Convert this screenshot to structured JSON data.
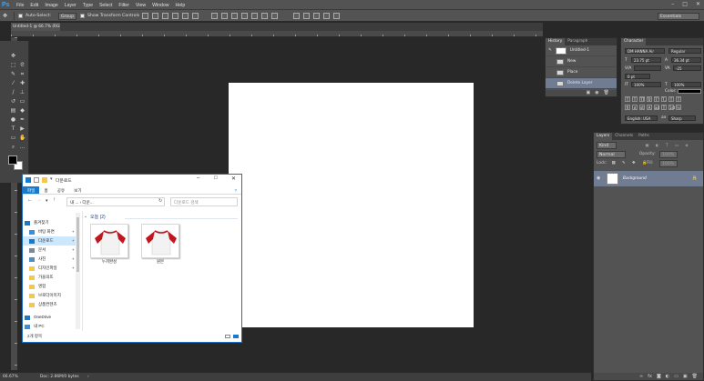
{
  "app": {
    "logo": "Ps",
    "menu": [
      "File",
      "Edit",
      "Image",
      "Layer",
      "Type",
      "Select",
      "Filter",
      "View",
      "Window",
      "Help"
    ],
    "window_controls": [
      "–",
      "□",
      "✕"
    ]
  },
  "options_bar": {
    "auto_select_label": "Auto-Select:",
    "auto_select_value": "Group",
    "show_transform_label": "Show Transform Controls",
    "workspace": "Essentials"
  },
  "document": {
    "tab_title": "Untitled-1 @ 66.7% (RGB/8) *"
  },
  "history_panel": {
    "tabs": [
      "History",
      "Paragraph"
    ],
    "snapshot": "Untitled-1",
    "items": [
      "New",
      "Place",
      "Delete Layer"
    ],
    "selected_index": 2
  },
  "character_panel": {
    "tab": "Character",
    "font_family": "DM HANNA Air",
    "font_style": "Regular",
    "font_size": "23.75 pt",
    "leading": "36.34 pt",
    "tracking": "-25",
    "kerning": "0 pt",
    "vertical_scale": "100%",
    "horizontal_scale": "100%",
    "color_label": "Color:",
    "style_buttons": [
      "T",
      "T",
      "TT",
      "Tr",
      "T'",
      "T,",
      "T",
      "T"
    ],
    "opentype_buttons": [
      "fi",
      "ơ",
      "st",
      "A",
      "ad",
      "T",
      "1st",
      "½"
    ],
    "language": "English: USA",
    "aa_label": "aa",
    "antialias": "Sharp"
  },
  "layers_panel": {
    "tabs": [
      "Layers",
      "Channels",
      "Paths"
    ],
    "filter_label": "Kind",
    "blend_mode": "Normal",
    "opacity_label": "Opacity:",
    "opacity": "100%",
    "lock_label": "Lock:",
    "fill_label": "Fill:",
    "fill": "100%",
    "layer_name": "Background"
  },
  "status_bar": {
    "zoom": "66.67%",
    "doc_info": "Doc: 2.86M/0 bytes"
  },
  "explorer": {
    "title": "다운로드",
    "ribbon_tabs": [
      "파일",
      "홈",
      "공유",
      "보기"
    ],
    "address": "내 ... › 다운...",
    "search_placeholder": "다운로드 검색",
    "group_header": "오늘 (2)",
    "sidebar": [
      {
        "label": "즐겨찾기",
        "icon": "star-icon",
        "pin": false,
        "sel": false
      },
      {
        "label": "바탕 화면",
        "icon": "desktop-icon",
        "pin": true,
        "sel": false
      },
      {
        "label": "다운로드",
        "icon": "download-icon",
        "pin": true,
        "sel": true
      },
      {
        "label": "문서",
        "icon": "document-icon",
        "pin": true,
        "sel": false
      },
      {
        "label": "사진",
        "icon": "pictures-icon",
        "pin": true,
        "sel": false
      },
      {
        "label": "디자인파일",
        "icon": "folder-icon",
        "pin": true,
        "sel": false
      },
      {
        "label": "가을의뜨",
        "icon": "folder-icon",
        "pin": false,
        "sel": false
      },
      {
        "label": "명함",
        "icon": "folder-icon",
        "pin": false,
        "sel": false
      },
      {
        "label": "브로더이미지",
        "icon": "folder-icon",
        "pin": false,
        "sel": false
      },
      {
        "label": "상품컨텐츠",
        "icon": "folder-icon",
        "pin": false,
        "sel": false
      },
      {
        "label": "OneDrive",
        "icon": "cloud-icon",
        "pin": false,
        "sel": false
      },
      {
        "label": "내 PC",
        "icon": "pc-icon",
        "pin": false,
        "sel": false
      }
    ],
    "files": [
      {
        "name": "누끼완성"
      },
      {
        "name": "원본"
      }
    ],
    "status": "2개 항목"
  },
  "colors": {
    "ps_blue": "#31a8ff",
    "selection_blue": "#6f7c92",
    "explorer_accent": "#1979ca",
    "shirt_red": "#c0161e"
  }
}
